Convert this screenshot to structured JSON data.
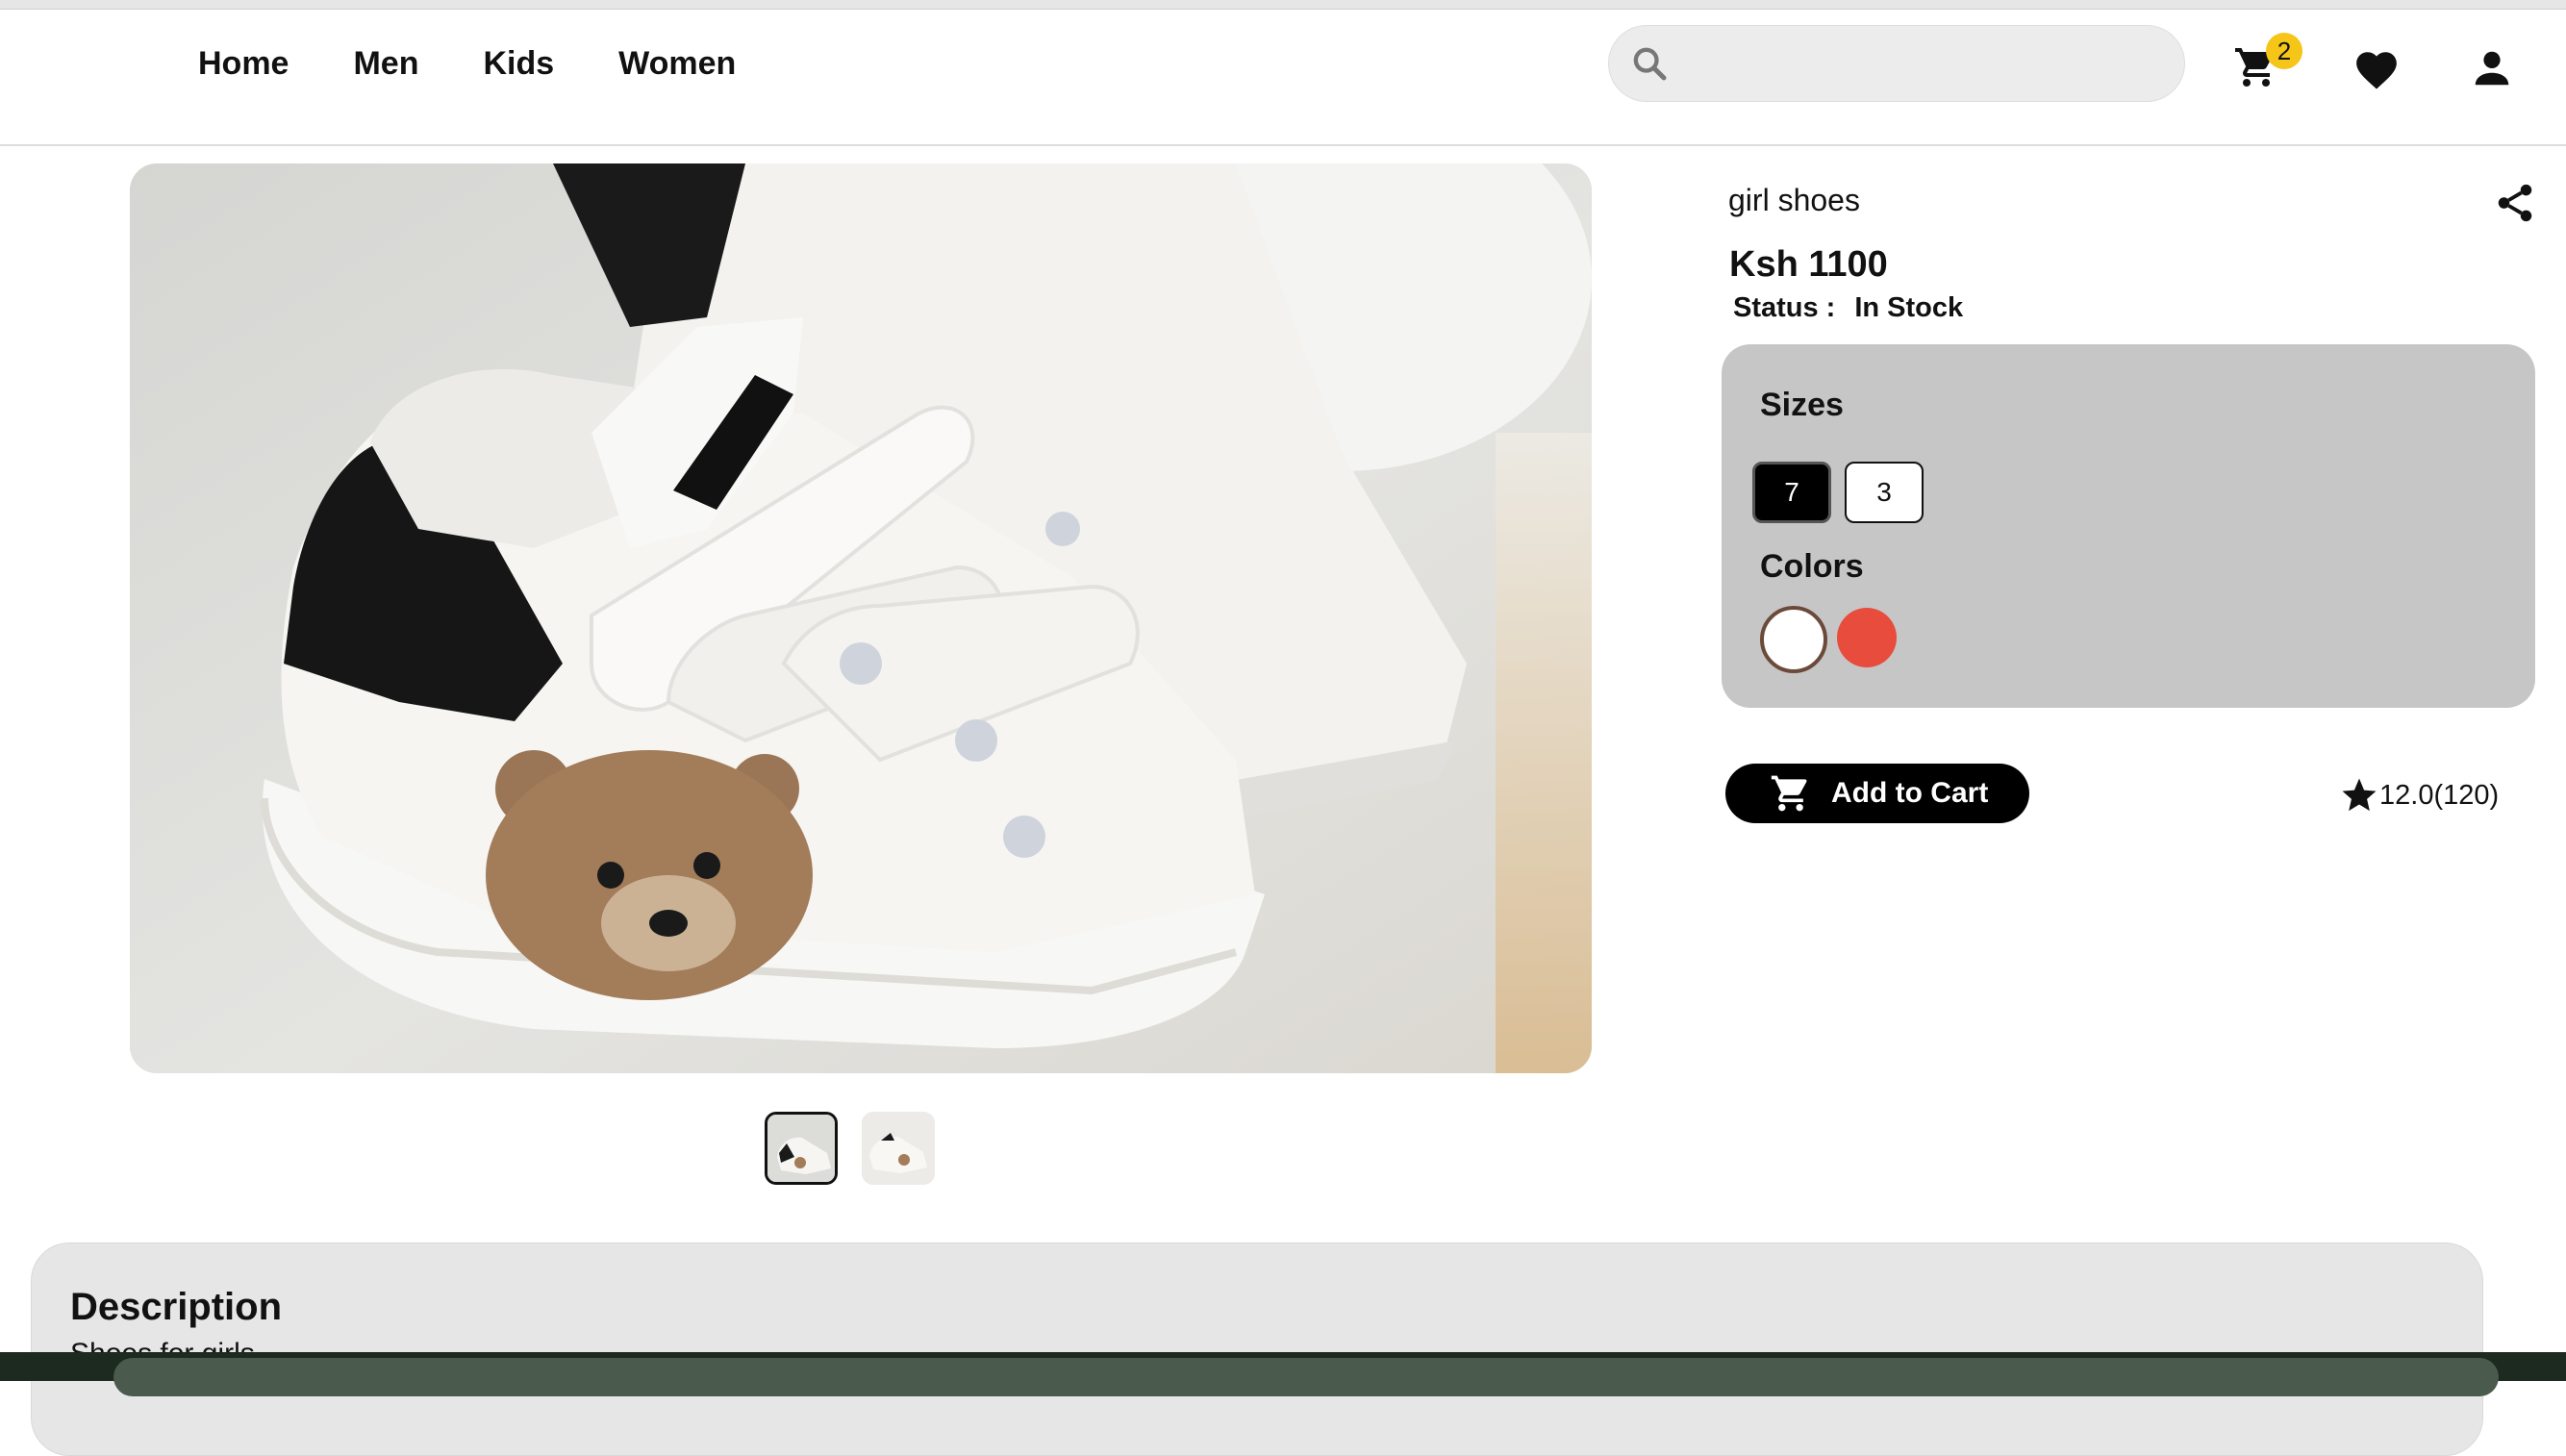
{
  "nav": {
    "links": [
      {
        "label": "Home"
      },
      {
        "label": "Men"
      },
      {
        "label": "Kids"
      },
      {
        "label": "Women"
      }
    ],
    "search": {
      "placeholder": "",
      "value": "",
      "icon": "search-icon"
    },
    "cart": {
      "icon": "cart-icon",
      "badge": "2"
    },
    "wishlist": {
      "icon": "heart-icon"
    },
    "account": {
      "icon": "user-icon"
    }
  },
  "product": {
    "name": "girl shoes",
    "price": "Ksh 1100",
    "status_label": "Status :",
    "status_value": "In Stock",
    "image_count": 2,
    "active_image": 0
  },
  "options": {
    "sizes_title": "Sizes",
    "sizes": [
      {
        "label": "7",
        "selected": true
      },
      {
        "label": "3",
        "selected": false
      }
    ],
    "colors_title": "Colors",
    "colors": [
      {
        "hex": "#ffffff",
        "selected": true
      },
      {
        "hex": "#e74c3c",
        "selected": false
      }
    ]
  },
  "actions": {
    "add_to_cart": "Add to Cart",
    "rating": "12.0(120)",
    "share_icon": "share-icon"
  },
  "description": {
    "title": "Description",
    "text": "Shoes for girls"
  }
}
